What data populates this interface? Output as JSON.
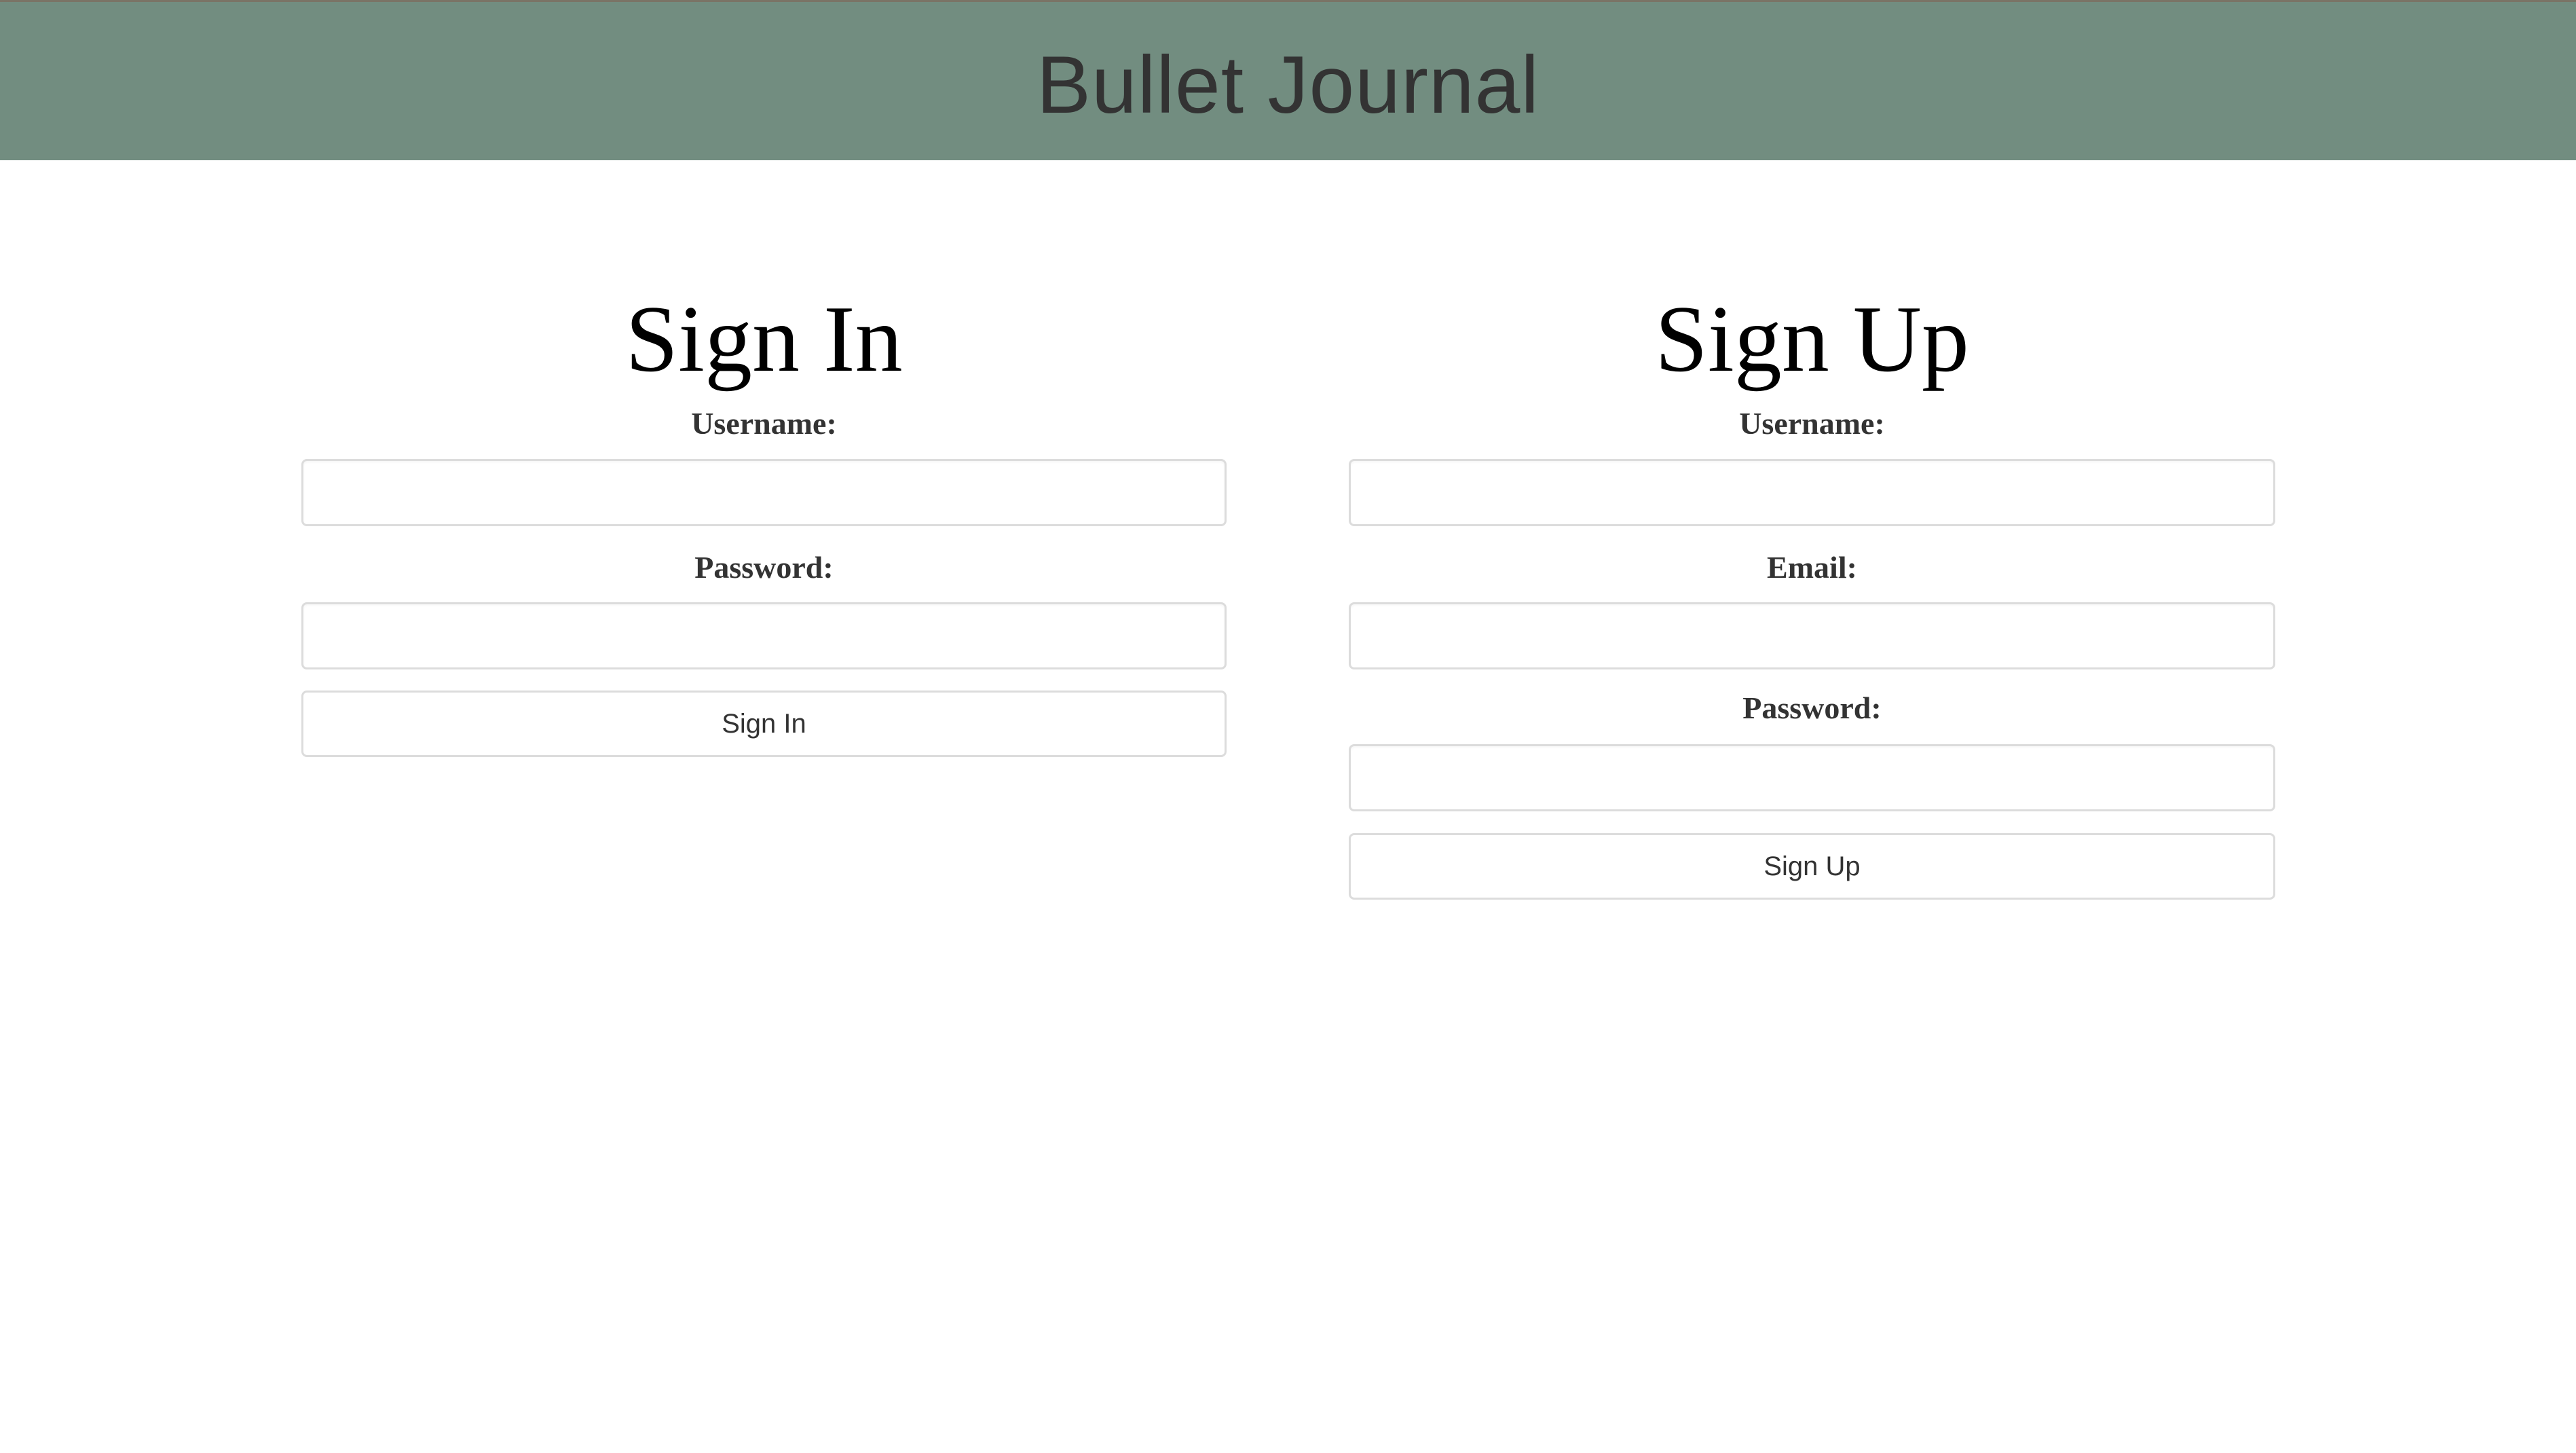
{
  "header": {
    "title": "Bullet Journal",
    "background": "#728d80"
  },
  "sign_in": {
    "heading": "Sign In",
    "username_label": "Username:",
    "username_value": "",
    "password_label": "Password:",
    "password_value": "",
    "submit_label": "Sign In"
  },
  "sign_up": {
    "heading": "Sign Up",
    "username_label": "Username:",
    "username_value": "",
    "email_label": "Email:",
    "email_value": "",
    "password_label": "Password:",
    "password_value": "",
    "submit_label": "Sign Up"
  }
}
